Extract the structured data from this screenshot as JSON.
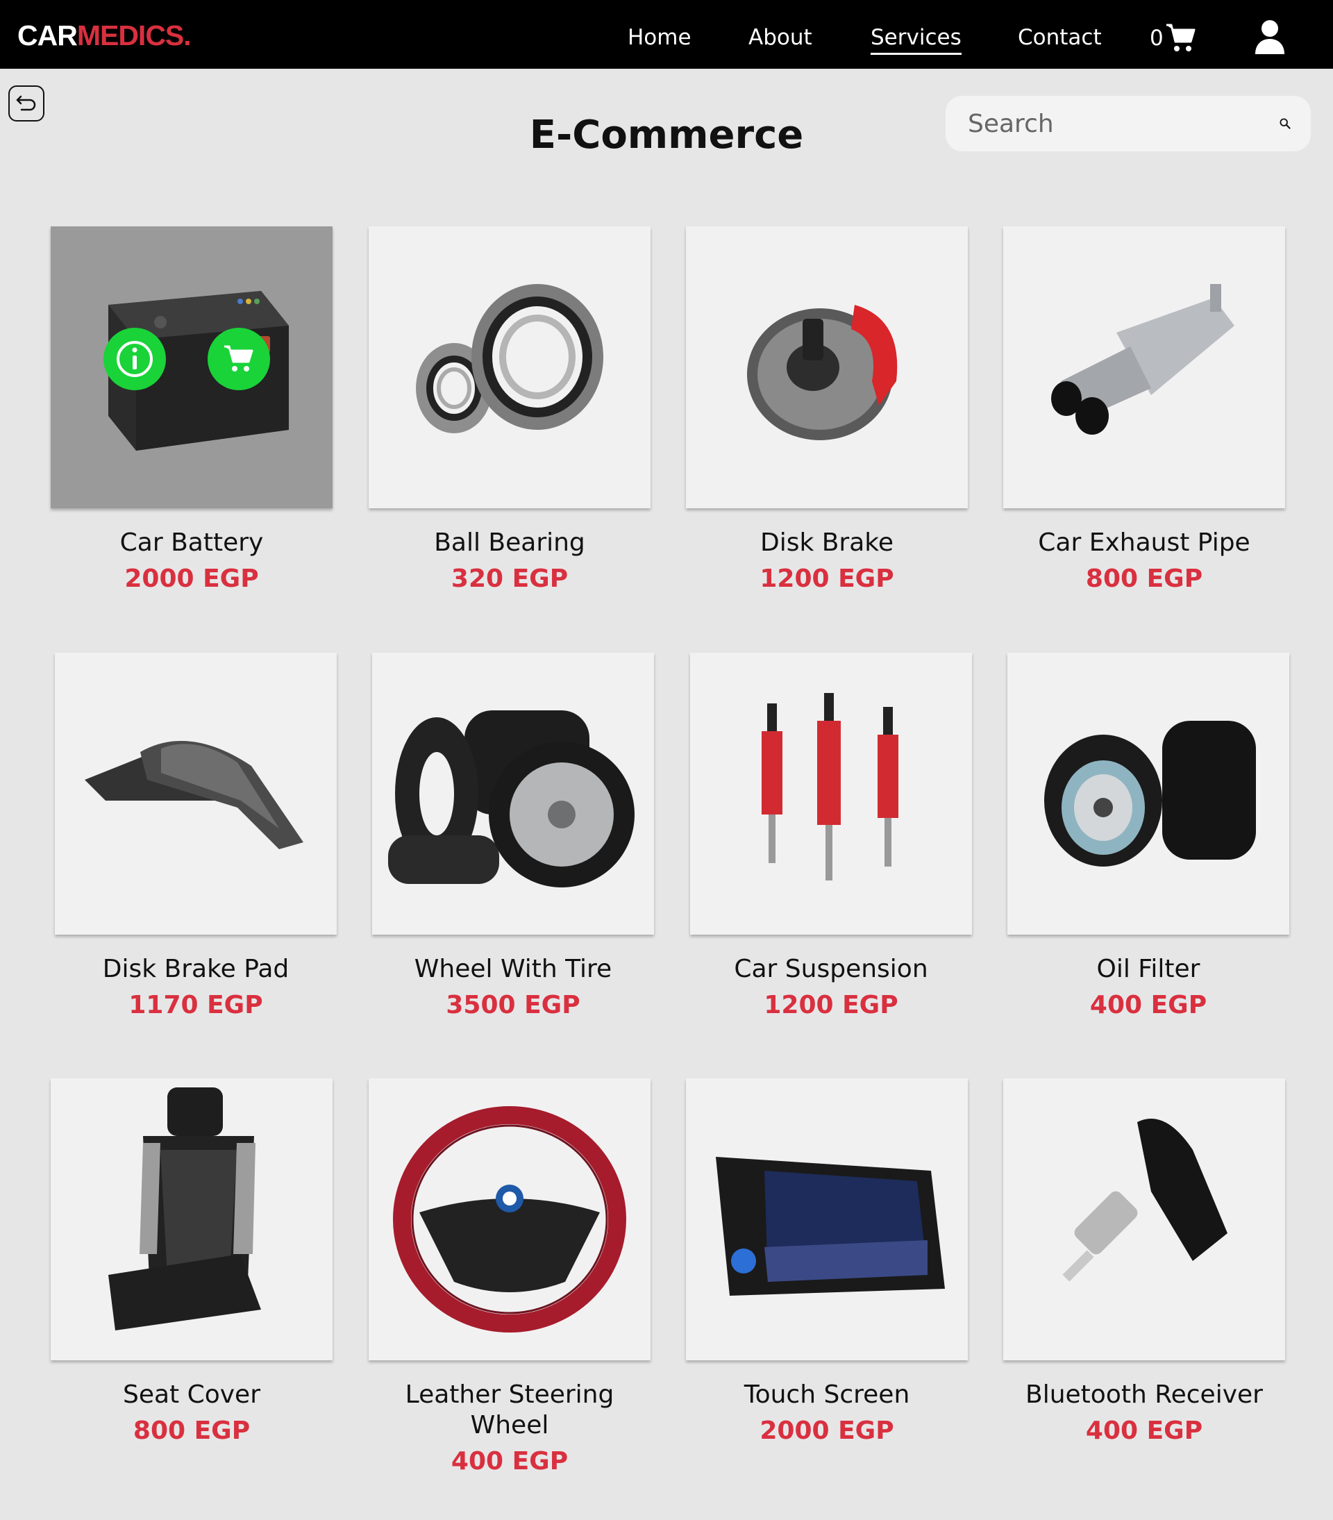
{
  "nav": {
    "logo_part1": "CAR",
    "logo_part2": "MEDICS.",
    "links": [
      "Home",
      "About",
      "Services",
      "Contact"
    ],
    "active": "Services",
    "cart_count": "0"
  },
  "page": {
    "title": "E-Commerce",
    "search_placeholder": "Search"
  },
  "products": [
    {
      "name": "Car Battery",
      "price": "2000 EGP",
      "icon": "battery"
    },
    {
      "name": "Ball Bearing",
      "price": "320 EGP",
      "icon": "bearing"
    },
    {
      "name": "Disk Brake",
      "price": "1200 EGP",
      "icon": "disk-brake"
    },
    {
      "name": "Car Exhaust Pipe",
      "price": "800 EGP",
      "icon": "exhaust"
    },
    {
      "name": "Disk Brake Pad",
      "price": "1170 EGP",
      "icon": "brake-pad"
    },
    {
      "name": "Wheel With Tire",
      "price": "3500 EGP",
      "icon": "wheel"
    },
    {
      "name": "Car Suspension",
      "price": "1200 EGP",
      "icon": "suspension"
    },
    {
      "name": "Oil Filter",
      "price": "400 EGP",
      "icon": "oil-filter"
    },
    {
      "name": "Seat Cover",
      "price": "800 EGP",
      "icon": "seat"
    },
    {
      "name": "Leather Steering Wheel",
      "price": "400 EGP",
      "icon": "steering"
    },
    {
      "name": "Touch Screen",
      "price": "2000 EGP",
      "icon": "touch-screen"
    },
    {
      "name": "Bluetooth Receiver",
      "price": "400 EGP",
      "icon": "bluetooth"
    }
  ],
  "colors": {
    "accent": "#d9303f",
    "overlay_button": "#19d338",
    "nav_bg": "#000000"
  }
}
